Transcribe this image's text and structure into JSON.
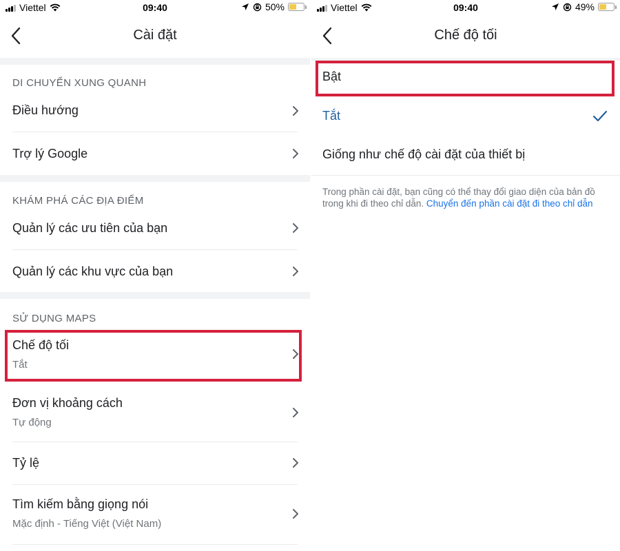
{
  "status_left": {
    "carrier": "Viettel",
    "time": "09:40",
    "battery_text": "50%",
    "battery_level": 0.5
  },
  "status_right": {
    "carrier": "Viettel",
    "time": "09:40",
    "battery_text": "49%",
    "battery_level": 0.49
  },
  "settings": {
    "title": "Cài đặt",
    "sections": [
      {
        "header": "DI CHUYỂN XUNG QUANH",
        "items": [
          {
            "label": "Điều hướng"
          },
          {
            "label": "Trợ lý Google"
          }
        ]
      },
      {
        "header": "KHÁM PHÁ CÁC ĐỊA ĐIỂM",
        "items": [
          {
            "label": "Quản lý các ưu tiên của bạn"
          },
          {
            "label": "Quản lý các khu vực của bạn"
          }
        ]
      },
      {
        "header": "SỬ DỤNG MAPS",
        "items": [
          {
            "label": "Chế độ tối",
            "sub": "Tắt"
          },
          {
            "label": "Đơn vị khoảng cách",
            "sub": "Tự động"
          },
          {
            "label": "Tỷ lệ"
          },
          {
            "label": "Tìm kiếm bằng giọng nói",
            "sub": "Mặc định - Tiếng Việt (Việt Nam)"
          }
        ]
      }
    ]
  },
  "dark_mode": {
    "title": "Chế độ tối",
    "options": [
      {
        "label": "Bật",
        "selected": false
      },
      {
        "label": "Tắt",
        "selected": true
      },
      {
        "label": "Giống như chế độ cài đặt của thiết bị",
        "selected": false
      }
    ],
    "note_text": "Trong phần cài đặt, bạn cũng có thể thay đổi giao diện của bản đồ trong khi đi theo chỉ dẫn.",
    "note_link": "Chuyển đến phần cài đặt đi theo chỉ dẫn"
  },
  "colors": {
    "highlight": "#d4213d",
    "selected_option": "#1f5f9f",
    "link": "#1a73e8",
    "battery": "#f2c94c"
  },
  "icons": [
    "signal-icon",
    "wifi-icon",
    "location-arrow-icon",
    "orientation-lock-icon",
    "battery-icon",
    "back-arrow-icon",
    "chevron-right-icon",
    "checkmark-icon"
  ]
}
